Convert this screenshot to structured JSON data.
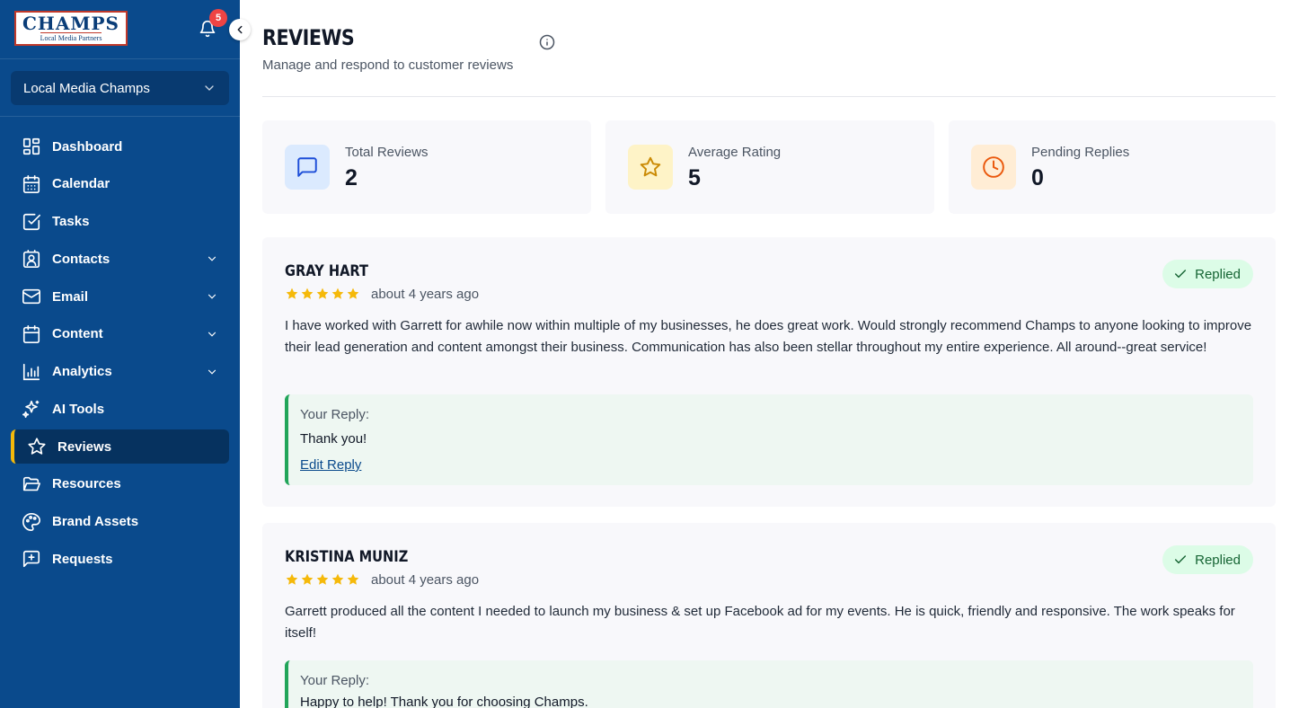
{
  "brand": {
    "logo_main": "CHAMPS",
    "logo_sub": "Local Media Partners"
  },
  "notifications": {
    "count": "5"
  },
  "org_selector": {
    "label": "Local Media Champs"
  },
  "sidebar": {
    "items": [
      {
        "label": "Dashboard"
      },
      {
        "label": "Calendar"
      },
      {
        "label": "Tasks"
      },
      {
        "label": "Contacts"
      },
      {
        "label": "Email"
      },
      {
        "label": "Content"
      },
      {
        "label": "Analytics"
      },
      {
        "label": "AI Tools"
      },
      {
        "label": "Reviews"
      },
      {
        "label": "Resources"
      },
      {
        "label": "Brand Assets"
      },
      {
        "label": "Requests"
      }
    ]
  },
  "header": {
    "title": "REVIEWS",
    "subtitle": "Manage and respond to customer reviews"
  },
  "stats": [
    {
      "label": "Total Reviews",
      "value": "2"
    },
    {
      "label": "Average Rating",
      "value": "5"
    },
    {
      "label": "Pending Replies",
      "value": "0"
    }
  ],
  "reviews": [
    {
      "name": "GRAY HART",
      "rating": 5,
      "time": "about 4 years ago",
      "status": "Replied",
      "text": "I have worked with Garrett for awhile now within multiple of my businesses, he does great work. Would strongly recommend Champs to anyone looking to improve their lead generation and content amongst their business. Communication has also been stellar throughout my entire experience. All around--great service!",
      "reply_label": "Your Reply:",
      "reply_text": "Thank you!",
      "edit_label": "Edit Reply"
    },
    {
      "name": "KRISTINA MUNIZ",
      "rating": 5,
      "time": "about 4 years ago",
      "status": "Replied",
      "text": "Garrett produced all the content I needed to launch my business & set up Facebook ad for my events. He is quick, friendly and responsive. The work speaks for itself!",
      "reply_label": "Your Reply:",
      "reply_text": "Happy to help! Thank you for choosing Champs."
    }
  ],
  "colors": {
    "sidebar_bg": "#0a4a8c",
    "active_accent": "#f5b90a",
    "star": "#f5b90a",
    "replied_bg": "#dcfce7",
    "reply_border": "#22a55a"
  }
}
